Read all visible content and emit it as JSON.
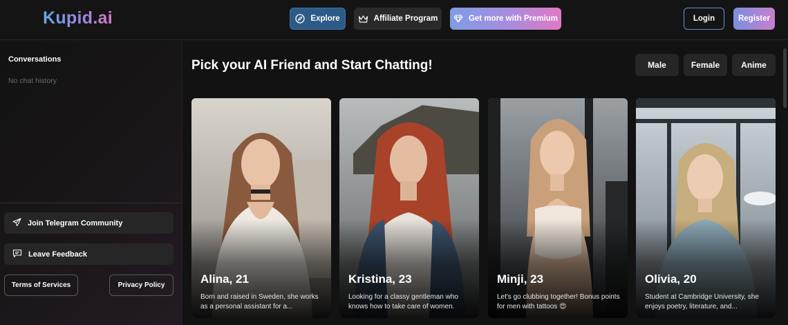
{
  "header": {
    "logo": "Kupid.ai",
    "nav": {
      "explore": "Explore",
      "affiliate": "Affiliate Program",
      "premium": "Get more with Premium"
    },
    "login": "Login",
    "register": "Register"
  },
  "sidebar": {
    "title": "Conversations",
    "empty": "No chat history",
    "telegram": "Join Telegram Community",
    "feedback": "Leave Feedback",
    "terms": "Terms of Services",
    "privacy": "Privacy Policy"
  },
  "main": {
    "title": "Pick your AI Friend and Start Chatting!",
    "filters": [
      "Male",
      "Female",
      "Anime"
    ],
    "cards": [
      {
        "name": "Alina, 21",
        "description": "Born and raised in Sweden, she works as a personal assistant for a..."
      },
      {
        "name": "Kristina, 23",
        "description": "Looking for a classy gentleman who knows how to take care of women."
      },
      {
        "name": "Minji, 23",
        "description": "Let's go clubbing together! Bonus points for men with tattoos 😍"
      },
      {
        "name": "Olivia, 20",
        "description": "Student at Cambridge University, she enjoys poetry, literature, and..."
      }
    ]
  },
  "colors": {
    "background": "#121212",
    "accent_blue": "#2e5a87",
    "premium_gradient": [
      "#7f9ce4",
      "#df79c4"
    ],
    "login_border": "#6c8fd0"
  },
  "icons": {
    "explore": "compass-icon",
    "affiliate": "crown-icon",
    "premium": "diamond-icon",
    "telegram": "paper-plane-icon",
    "feedback": "chat-bubble-icon"
  }
}
